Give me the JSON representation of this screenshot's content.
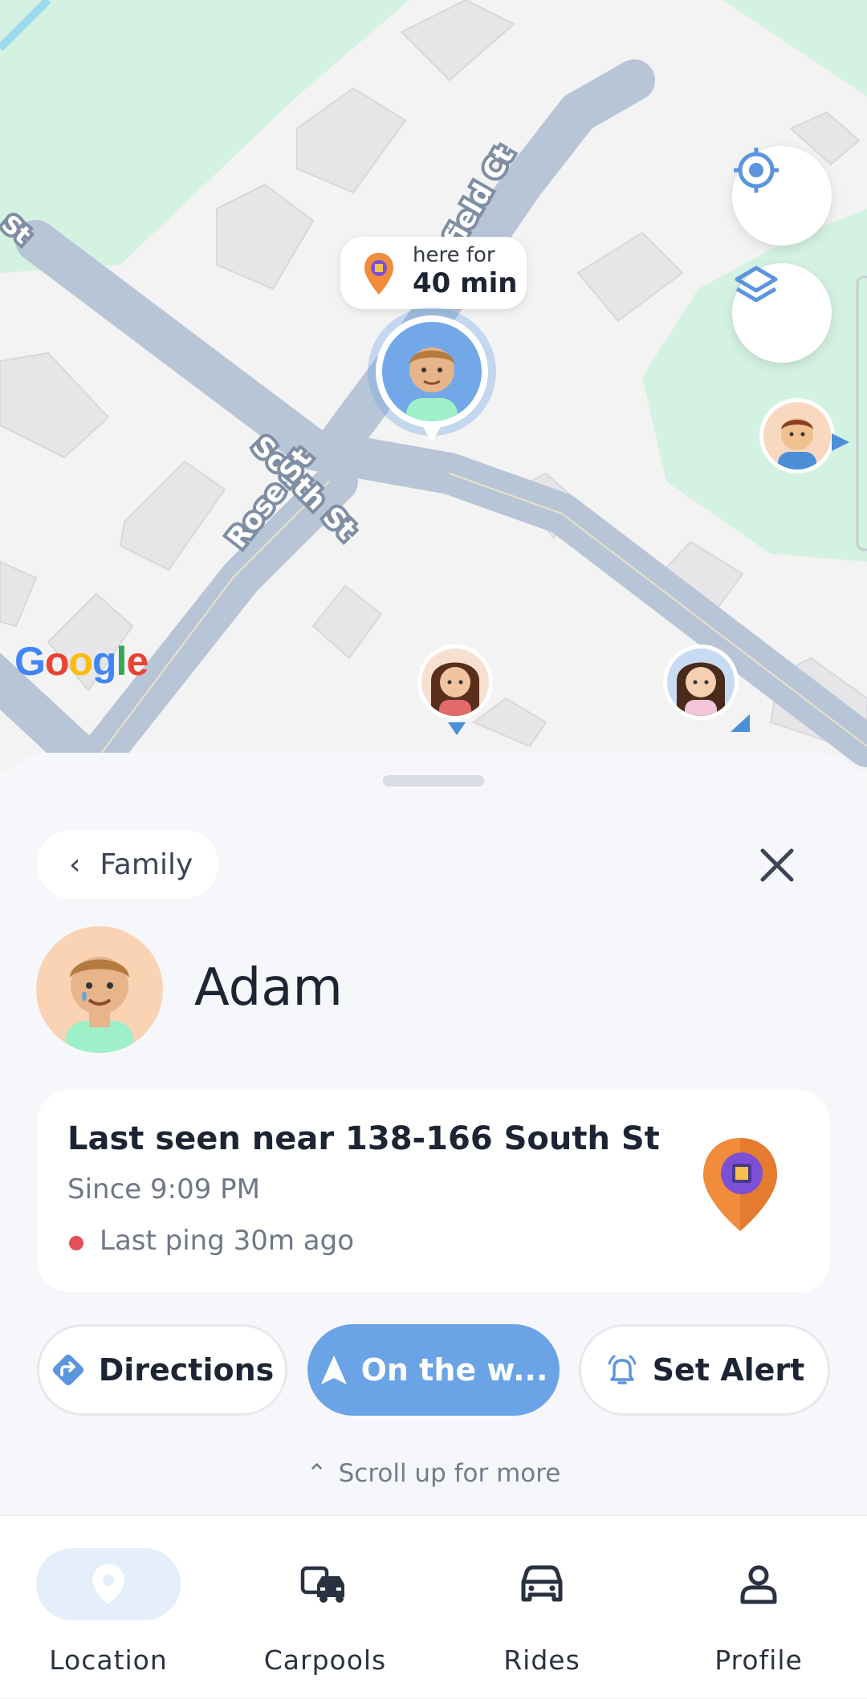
{
  "map": {
    "streets": [
      "South St",
      "Rose St",
      "field Ct",
      "St"
    ],
    "logo": "Google",
    "bubble": {
      "line1": "here for",
      "line2": "40 min"
    },
    "controls": {
      "locate_icon": "crosshair-icon",
      "layers_icon": "layers-icon"
    }
  },
  "sheet": {
    "back_label": "Family",
    "person_name": "Adam",
    "card": {
      "title": "Last seen near 138-166 South St",
      "since": "Since 9:09 PM",
      "ping": "Last ping 30m ago",
      "ping_color": "#e4505a"
    },
    "actions": [
      {
        "label": "Directions",
        "icon": "directions-icon"
      },
      {
        "label": "On the w...",
        "icon": "navigation-arrow-icon"
      },
      {
        "label": "Set Alert",
        "icon": "alarm-bell-icon"
      }
    ],
    "scroll_hint": "Scroll up for more"
  },
  "nav": [
    {
      "label": "Location",
      "icon": "location-pin-icon",
      "active": true
    },
    {
      "label": "Carpools",
      "icon": "carpool-icon",
      "active": false
    },
    {
      "label": "Rides",
      "icon": "car-icon",
      "active": false
    },
    {
      "label": "Profile",
      "icon": "person-icon",
      "active": false
    }
  ],
  "colors": {
    "accent": "#6aa4e6",
    "map_green": "#d7f3e3",
    "road": "#b7c4d6"
  }
}
